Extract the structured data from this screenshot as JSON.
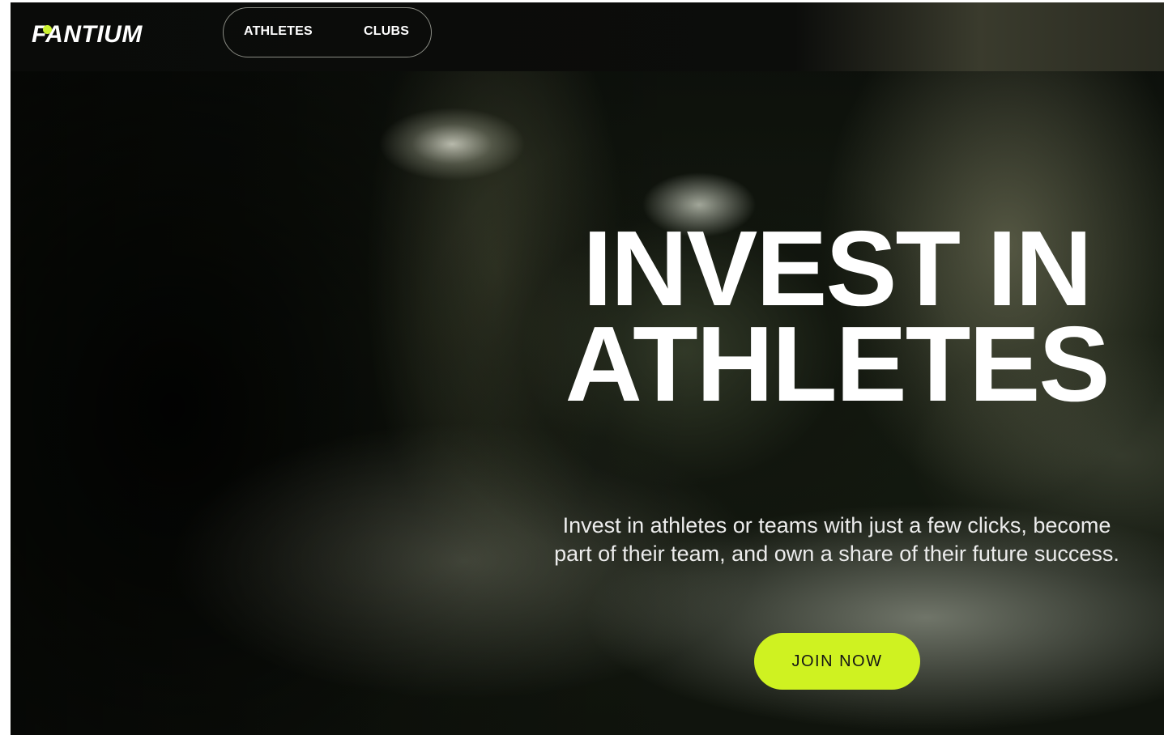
{
  "brand": {
    "logo_text": "FANTIUM",
    "accent_color": "#cff221"
  },
  "nav": {
    "items": [
      {
        "label": "ATHLETES"
      },
      {
        "label": "CLUBS"
      }
    ]
  },
  "hero": {
    "headline_line1": "INVEST IN",
    "headline_line2": "ATHLETES",
    "subtitle": "Invest in athletes or teams with just a few clicks, become part of their team, and own a share of their future success.",
    "cta_label": "JOIN NOW"
  }
}
